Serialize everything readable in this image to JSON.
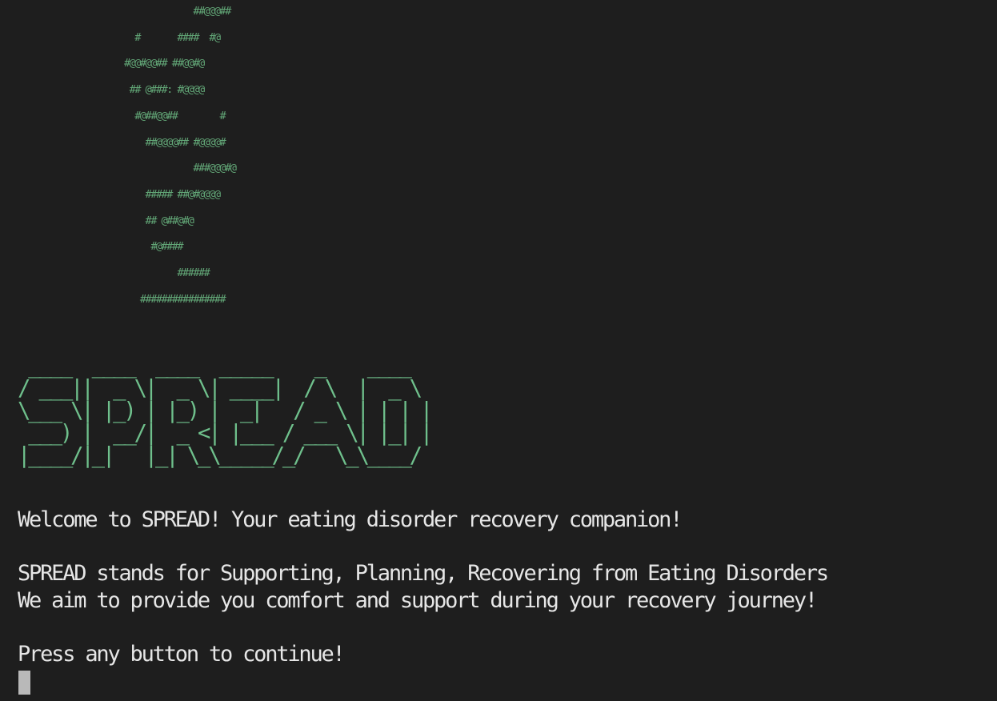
{
  "terminal": {
    "plant_art": "             ##@@@##\n  #       ####  #@\n#@@#@@## ##@@#@\n ## @###: #@@@@\n  #@##@@##        #\n    ##@@@@## #@@@@#\n             ###@@@#@\n    ##### ##@#@@@@\n    ## @##@#@\n     #@####\n          ######\n   ################",
    "logo_art": " ____  ____  ____  _____    _    ____\n/ ___||  _ \\|  _ \\| ____|  / \\  |  _ \\\n\\___ \\| |_) | |_) |  _|   / _ \\ | | | |\n ___) |  __/|  _ <| |___ / ___ \\| |_| |\n|____/|_|   |_| \\_\\_____/_/   \\_\\____/",
    "welcome": "Welcome to SPREAD! Your eating disorder recovery companion!",
    "stands_for": "SPREAD stands for Supporting, Planning, Recovering from Eating Disorders",
    "aim": "We aim to provide you comfort and support during your recovery journey!",
    "prompt": "Press any button to continue!"
  },
  "colors": {
    "background": "#1e1e1e",
    "text": "#e6e6e6",
    "ascii_green": "#6fc08c",
    "cursor": "#b9b9b9"
  }
}
